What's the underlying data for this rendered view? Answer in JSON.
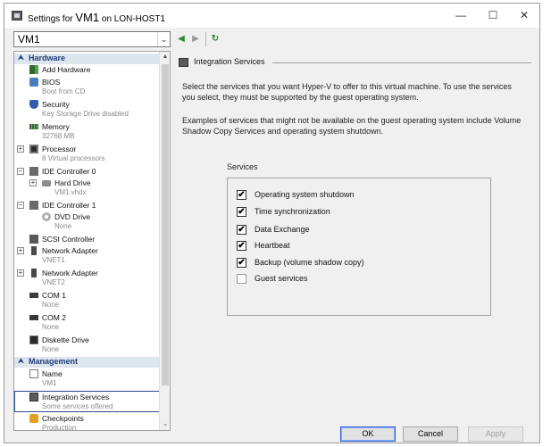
{
  "window": {
    "title_prefix": "Settings for",
    "title_vm": "VM1",
    "title_host": "on LON-HOST1",
    "minimize_glyph": "—",
    "maximize_glyph": "☐",
    "close_glyph": "✕"
  },
  "toolbar": {
    "vm_selector": "VM1",
    "dropdown_glyph": "⌄",
    "back_glyph": "◀",
    "forward_glyph": "▶",
    "refresh_glyph": "↻"
  },
  "nav": {
    "hardware_header": "Hardware",
    "management_header": "Management",
    "collapse_glyph": "⮝",
    "expand_glyph": "+",
    "scroll_up_glyph": "▲",
    "scroll_down_glyph": "⌄",
    "hardware_items": [
      {
        "label": "Add Hardware",
        "sub": "",
        "icon": "add-hardware-icon"
      },
      {
        "label": "BIOS",
        "sub": "Boot from CD",
        "icon": "bios-icon"
      },
      {
        "label": "Security",
        "sub": "Key Storage Drive disabled",
        "icon": "security-shield-icon"
      },
      {
        "label": "Memory",
        "sub": "32768 MB",
        "icon": "memory-icon"
      },
      {
        "label": "Processor",
        "sub": "8 Virtual processors",
        "icon": "processor-icon"
      },
      {
        "label": "IDE Controller 0",
        "sub": "",
        "icon": "ide-controller-icon"
      },
      {
        "label": "Hard Drive",
        "sub": "VM1.vhdx",
        "icon": "hard-drive-icon"
      },
      {
        "label": "IDE Controller 1",
        "sub": "",
        "icon": "ide-controller-icon"
      },
      {
        "label": "DVD Drive",
        "sub": "None",
        "icon": "dvd-drive-icon"
      },
      {
        "label": "SCSI Controller",
        "sub": "",
        "icon": "scsi-controller-icon"
      },
      {
        "label": "Network Adapter",
        "sub": "VNET1",
        "icon": "network-adapter-icon"
      },
      {
        "label": "Network Adapter",
        "sub": "VNET2",
        "icon": "network-adapter-icon"
      },
      {
        "label": "COM 1",
        "sub": "None",
        "icon": "com-port-icon"
      },
      {
        "label": "COM 2",
        "sub": "None",
        "icon": "com-port-icon"
      },
      {
        "label": "Diskette Drive",
        "sub": "None",
        "icon": "diskette-drive-icon"
      }
    ],
    "management_items": [
      {
        "label": "Name",
        "sub": "VM1",
        "icon": "name-icon"
      },
      {
        "label": "Integration Services",
        "sub": "Some services offered",
        "icon": "integration-services-icon"
      },
      {
        "label": "Checkpoints",
        "sub": "Production",
        "icon": "checkpoints-icon"
      }
    ]
  },
  "content": {
    "group_title": "Integration Services",
    "paragraph1": "Select the services that you want Hyper-V to offer to this virtual machine. To use the services you select, they must be supported by the guest operating system.",
    "paragraph2": "Examples of services that might not be available on the guest operating system include Volume Shadow Copy Services and operating system shutdown.",
    "services_label": "Services",
    "check_glyph": "✔",
    "services": [
      {
        "label": "Operating system shutdown",
        "checked": true
      },
      {
        "label": "Time synchronization",
        "checked": true
      },
      {
        "label": "Data Exchange",
        "checked": true
      },
      {
        "label": "Heartbeat",
        "checked": true
      },
      {
        "label": "Backup (volume shadow copy)",
        "checked": true
      },
      {
        "label": "Guest services",
        "checked": false
      }
    ]
  },
  "buttons": {
    "ok": "OK",
    "cancel": "Cancel",
    "apply": "Apply"
  }
}
